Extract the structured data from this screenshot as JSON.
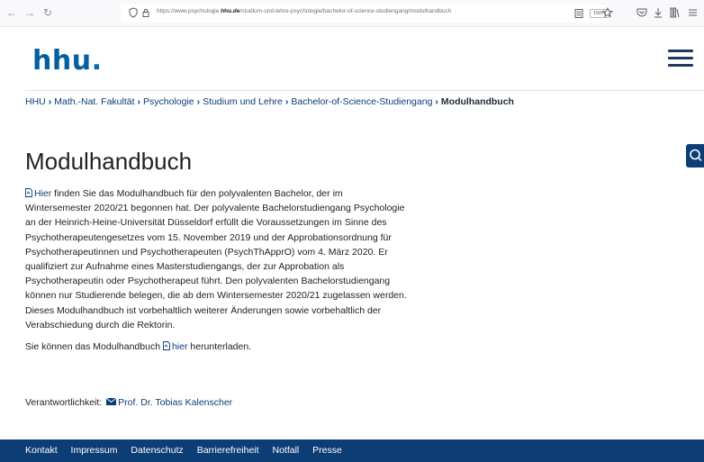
{
  "browser": {
    "url_prefix": "https://www.psychologie.",
    "url_domain": "hhu.de",
    "url_suffix": "/studium-und-lehre-psychologie/bachelor-of-science-studiengang/modulhandbuch",
    "zoom": "150%"
  },
  "site": {
    "logo": "hhu",
    "logo_dot": "."
  },
  "breadcrumb": {
    "items": [
      "HHU",
      "Math.-Nat. Fakultät",
      "Psychologie",
      "Studium und Lehre",
      "Bachelor-of-Science-Studiengang"
    ],
    "current": "Modulhandbuch",
    "separator": "›"
  },
  "page": {
    "title": "Modulhandbuch",
    "intro_link": "Hier",
    "intro_lines": [
      " finden Sie das Modulhandbuch für den polyvalenten Bachelor, der im",
      "Wintersemester 2020/21 begonnen hat. Der polyvalente Bachelorstudiengang Psychologie",
      "an der Heinrich-Heine-Universität Düsseldorf erfüllt die Voraussetzungen im Sinne des",
      "Psychotherapeutengesetzes vom 15. November 2019 und der Approbationsordnung für",
      "Psychotherapeutinnen und Psychotherapeuten (PsychThApprO) vom 4. März 2020. Er",
      "qualifiziert zur Aufnahme eines Masterstudiengangs, der zur Approbation als",
      "Psychotherapeutin oder Psychotherapeut führt. Den polyvalenten Bachelorstudiengang",
      "können nur Studierende belegen, die ab dem Wintersemester 2020/21 zugelassen werden.",
      "Dieses Modulhandbuch ist vorbehaltlich weiterer Änderungen sowie vorbehaltlich der",
      "Verabschiedung durch die Rektorin."
    ],
    "download_prefix": "Sie können das Modulhandbuch ",
    "download_link": "hier",
    "download_suffix": " herunterladen.",
    "responsible_label": "Verantwortlichkeit:",
    "responsible_name": "Prof. Dr. Tobias Kalenscher"
  },
  "footer": {
    "links": [
      "Kontakt",
      "Impressum",
      "Datenschutz",
      "Barrierefreiheit",
      "Notfall",
      "Presse"
    ]
  },
  "colors": {
    "brand": "#0c3d75",
    "logo": "#0060a0"
  }
}
